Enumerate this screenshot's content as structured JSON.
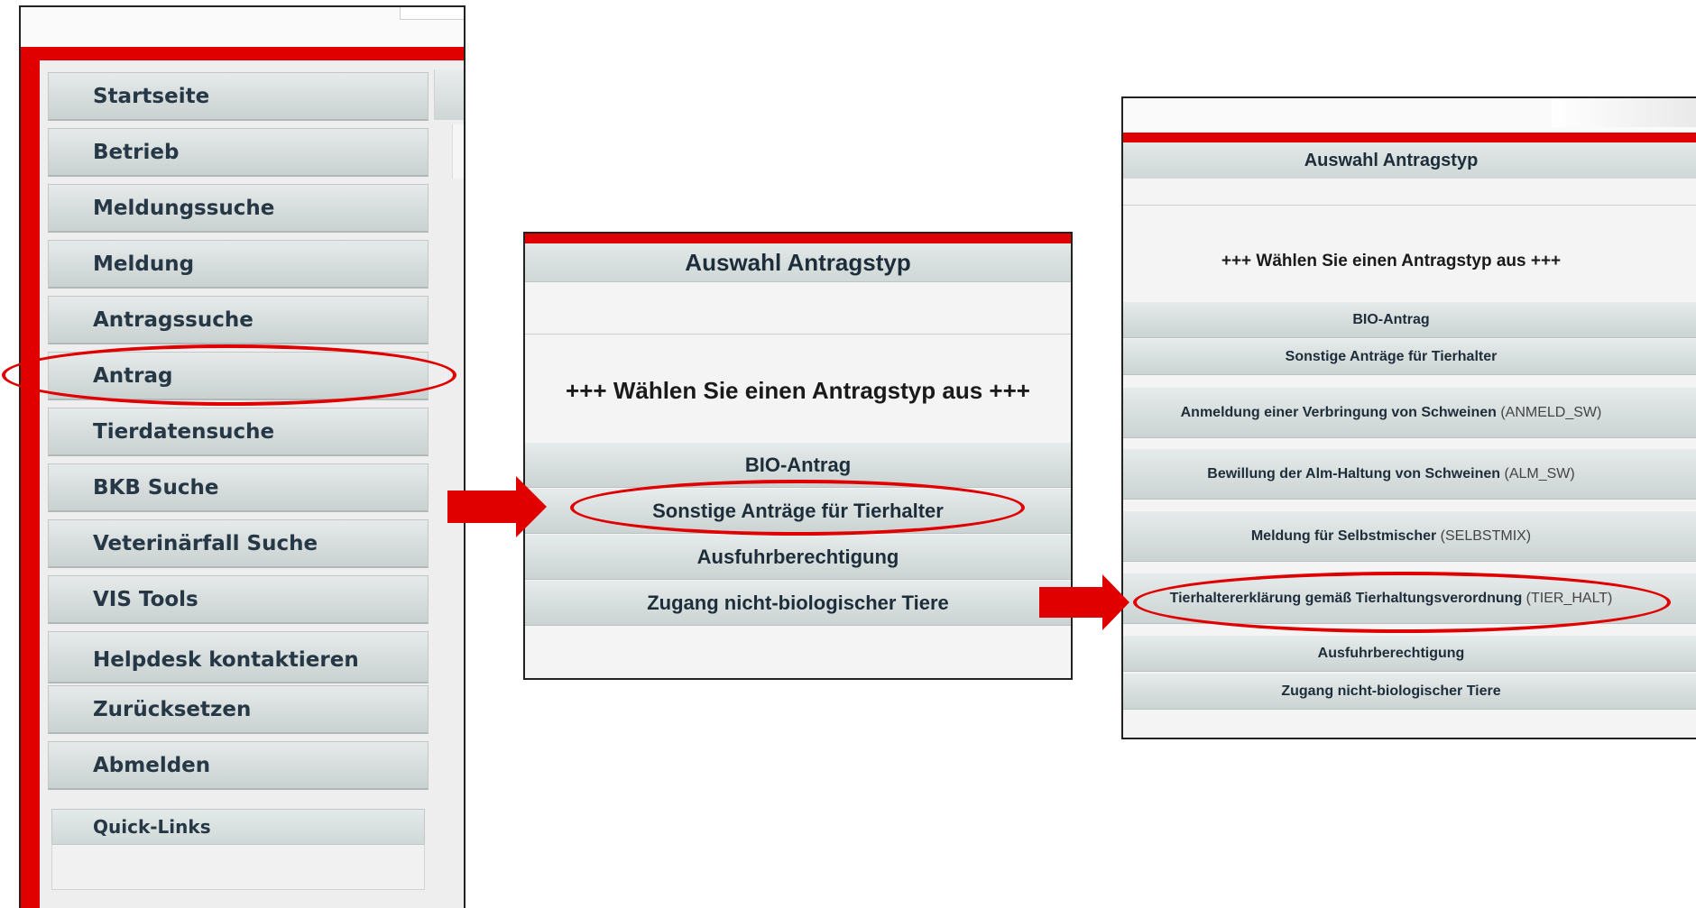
{
  "sidebar": {
    "items": [
      {
        "label": "Startseite"
      },
      {
        "label": "Betrieb"
      },
      {
        "label": "Meldungssuche"
      },
      {
        "label": "Meldung"
      },
      {
        "label": "Antragssuche"
      },
      {
        "label": "Antrag"
      },
      {
        "label": "Tierdatensuche"
      },
      {
        "label": "BKB Suche"
      },
      {
        "label": "Veterinärfall Suche"
      },
      {
        "label": "VIS Tools"
      },
      {
        "label": "Helpdesk kontaktieren"
      },
      {
        "label": "Zurücksetzen"
      },
      {
        "label": "Abmelden"
      }
    ],
    "quick_links": "Quick-Links",
    "highlighted_item": "Antrag"
  },
  "panel2": {
    "header": "Auswahl Antragstyp",
    "prompt": "+++ Wählen Sie einen Antragstyp aus +++",
    "buttons": [
      {
        "label": "BIO-Antrag"
      },
      {
        "label": "Sonstige Anträge für Tierhalter"
      },
      {
        "label": "Ausfuhrberechtigung"
      },
      {
        "label": "Zugang nicht-biologischer Tiere"
      }
    ],
    "highlighted_button": "Sonstige Anträge für Tierhalter"
  },
  "panel3": {
    "header": "Auswahl Antragstyp",
    "prompt": "+++ Wählen Sie einen Antragstyp aus +++",
    "buttons": [
      {
        "label": "BIO-Antrag",
        "code": ""
      },
      {
        "label": "Sonstige Anträge für Tierhalter",
        "code": ""
      },
      {
        "label": "Anmeldung einer Verbringung von Schweinen",
        "code": "(ANMELD_SW)"
      },
      {
        "label": "Bewillung der Alm-Haltung von Schweinen",
        "code": "(ALM_SW)"
      },
      {
        "label": "Meldung für Selbstmischer",
        "code": "(SELBSTMIX)"
      },
      {
        "label": "Tierhaltererklärung gemäß Tierhaltungsverordnung",
        "code": "(TIER_HALT)"
      },
      {
        "label": "Ausfuhrberechtigung",
        "code": ""
      },
      {
        "label": "Zugang nicht-biologischer Tiere",
        "code": ""
      }
    ],
    "highlighted_button": "Tierhaltererklärung gemäß Tierhaltungsverordnung"
  },
  "colors": {
    "accent_red": "#e00000",
    "button_text": "#263746",
    "frame": "#222222"
  }
}
